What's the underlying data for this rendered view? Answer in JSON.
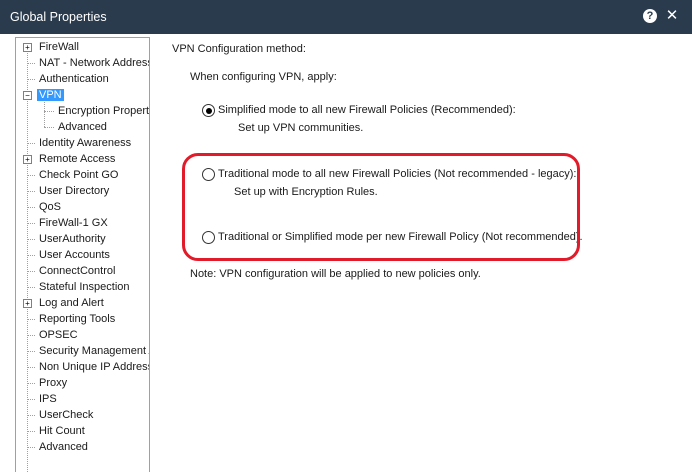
{
  "window": {
    "title": "Global Properties",
    "help_glyph": "?",
    "close_glyph": "✕"
  },
  "tree": {
    "items": [
      {
        "label": "FireWall",
        "expander": "+"
      },
      {
        "label": "NAT - Network Address Translation"
      },
      {
        "label": "Authentication"
      },
      {
        "label": "VPN",
        "expander": "−",
        "selected": true
      },
      {
        "label": "Encryption Properties",
        "child": true
      },
      {
        "label": "Advanced",
        "child": true
      },
      {
        "label": "Identity Awareness"
      },
      {
        "label": "Remote Access",
        "expander": "+"
      },
      {
        "label": "Check Point GO"
      },
      {
        "label": "User Directory"
      },
      {
        "label": "QoS"
      },
      {
        "label": "FireWall-1 GX"
      },
      {
        "label": "UserAuthority"
      },
      {
        "label": "User Accounts"
      },
      {
        "label": "ConnectControl"
      },
      {
        "label": "Stateful Inspection"
      },
      {
        "label": "Log and Alert",
        "expander": "+"
      },
      {
        "label": "Reporting Tools"
      },
      {
        "label": "OPSEC"
      },
      {
        "label": "Security Management Access"
      },
      {
        "label": "Non Unique IP Address Ranges"
      },
      {
        "label": "Proxy"
      },
      {
        "label": "IPS"
      },
      {
        "label": "UserCheck"
      },
      {
        "label": "Hit Count"
      },
      {
        "label": "Advanced"
      }
    ]
  },
  "content": {
    "section_title": "VPN Configuration method:",
    "apply_label": "When configuring VPN, apply:",
    "options": [
      {
        "label": "Simplified mode to all new Firewall Policies (Recommended):",
        "sub": "Set up VPN communities.",
        "checked": true
      },
      {
        "label": "Traditional mode to all new Firewall Policies (Not recommended - legacy):",
        "sub": "Set up with Encryption Rules.",
        "checked": false
      },
      {
        "label": "Traditional or Simplified mode per new Firewall Policy (Not recommended).",
        "sub": "",
        "checked": false
      }
    ],
    "note": "Note: VPN configuration will be applied to new policies only."
  },
  "colors": {
    "titlebar": "#2a3b4d",
    "selection": "#3399ff",
    "highlight_border": "#e21b2b"
  }
}
